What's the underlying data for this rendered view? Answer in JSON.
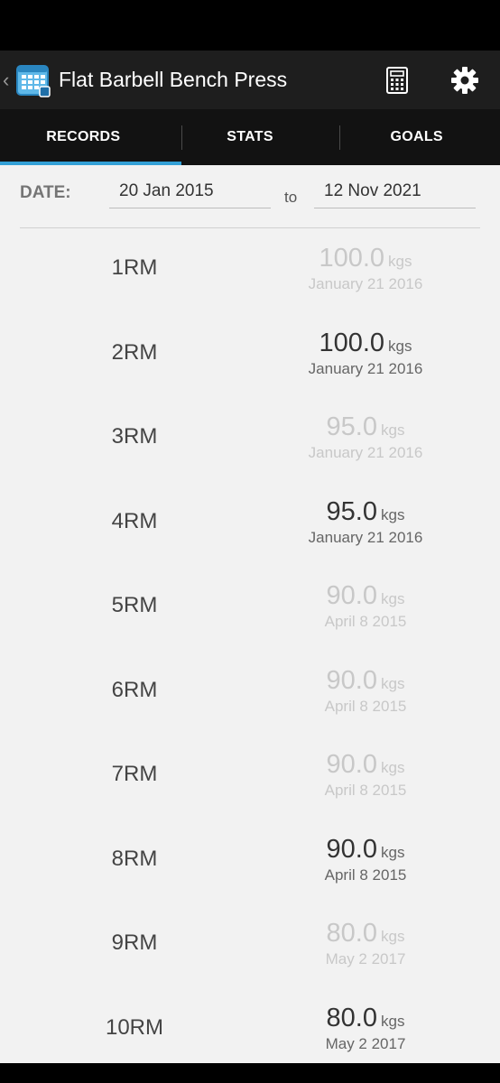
{
  "app_bar": {
    "title": "Flat Barbell Bench Press",
    "back_glyph": "‹",
    "icons": [
      "chevron-left-icon",
      "calendar-app-icon",
      "calculator-icon",
      "gear-icon"
    ]
  },
  "tabs": [
    {
      "label": "RECORDS",
      "active": true
    },
    {
      "label": "STATS",
      "active": false
    },
    {
      "label": "GOALS",
      "active": false
    }
  ],
  "date_filter": {
    "label": "DATE:",
    "from": "20 Jan 2015",
    "to_label": "to",
    "to": "12 Nov 2021"
  },
  "records": [
    {
      "rm": "1RM",
      "weight": "100.0",
      "unit": "kgs",
      "date": "January 21 2016",
      "faded": true
    },
    {
      "rm": "2RM",
      "weight": "100.0",
      "unit": "kgs",
      "date": "January 21 2016",
      "faded": false
    },
    {
      "rm": "3RM",
      "weight": "95.0",
      "unit": "kgs",
      "date": "January 21 2016",
      "faded": true
    },
    {
      "rm": "4RM",
      "weight": "95.0",
      "unit": "kgs",
      "date": "January 21 2016",
      "faded": false
    },
    {
      "rm": "5RM",
      "weight": "90.0",
      "unit": "kgs",
      "date": "April 8 2015",
      "faded": true
    },
    {
      "rm": "6RM",
      "weight": "90.0",
      "unit": "kgs",
      "date": "April 8 2015",
      "faded": true
    },
    {
      "rm": "7RM",
      "weight": "90.0",
      "unit": "kgs",
      "date": "April 8 2015",
      "faded": true
    },
    {
      "rm": "8RM",
      "weight": "90.0",
      "unit": "kgs",
      "date": "April 8 2015",
      "faded": false
    },
    {
      "rm": "9RM",
      "weight": "80.0",
      "unit": "kgs",
      "date": "May 2 2017",
      "faded": true
    },
    {
      "rm": "10RM",
      "weight": "80.0",
      "unit": "kgs",
      "date": "May 2 2017",
      "faded": false
    }
  ],
  "colors": {
    "accent": "#33a0d6",
    "app_bar": "#1e1e1e",
    "tab_bar": "#121212",
    "background": "#f2f2f2"
  }
}
